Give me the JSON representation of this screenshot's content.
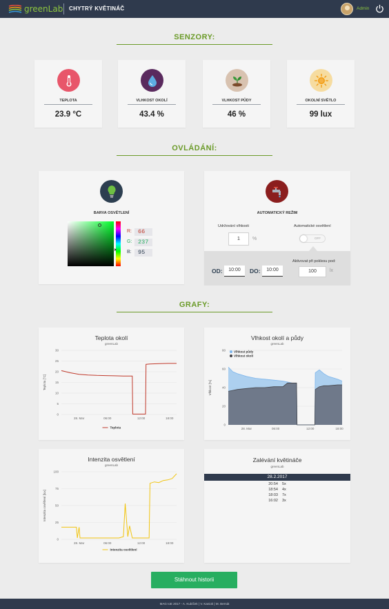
{
  "header": {
    "logo_text": "greenLab",
    "app_title": "CHYTRÝ KVĚTINÁČ",
    "user": "Admin"
  },
  "sections": {
    "sensors": "SENZORY:",
    "control": "OVLÁDÁNÍ:",
    "graphs": "GRAFY:"
  },
  "sensors": [
    {
      "label": "TEPLOTA",
      "value": "23.9 °C",
      "icon": "thermometer-icon",
      "color": "#e8566a"
    },
    {
      "label": "VLHKOST OKOLÍ",
      "value": "43.4 %",
      "icon": "water-drop-icon",
      "color": "#5a2a5e"
    },
    {
      "label": "VLHKOST PŮDY",
      "value": "46 %",
      "icon": "plant-icon",
      "color": "#d8c2b0"
    },
    {
      "label": "OKOLNÍ SVĚTLO",
      "value": "99 lux",
      "icon": "sun-icon",
      "color": "#f6dca0"
    }
  ],
  "lighting": {
    "label": "BARVA OSVĚTLENÍ",
    "r_label": "R:",
    "g_label": "G:",
    "b_label": "B:",
    "r": "66",
    "g": "237",
    "b": "95"
  },
  "auto": {
    "label": "AUTOMATICKÝ REŽIM",
    "humidity_label": "Udržování vlhkosti",
    "humidity_value": "1",
    "humidity_unit": "%",
    "light_label": "Automatické osvětlení",
    "toggle_text": "OFF",
    "od_label": "OD:",
    "od_value": "10:00",
    "do_label": "DO:",
    "do_value": "10:00",
    "threshold_label": "Aktivovat při poklesu pod:",
    "threshold_value": "100",
    "threshold_unit": "lx"
  },
  "charts": {
    "temp": {
      "title": "Teplota okolí",
      "subtitle": "greenLab",
      "ylabel": "Teplota [°C]",
      "legend": "Teplota"
    },
    "humidity": {
      "title": "Vlhkost okolí a půdy",
      "subtitle": "greenLab",
      "ylabel": "Vlhkost [%]",
      "legend_soil": "Vlhkost půdy",
      "legend_air": "Vlhkost okolí"
    },
    "light": {
      "title": "Intenzita osvětlení",
      "subtitle": "greenLab",
      "ylabel": "Intenzita osvětlení [lux]",
      "legend": "Intenzita osvětlení"
    }
  },
  "watering": {
    "title": "Zalévání květináče",
    "subtitle": "greenLab",
    "date": "28.2.2017",
    "rows": [
      {
        "time": "20:54",
        "count": "5x"
      },
      {
        "time": "18:54",
        "count": "4x"
      },
      {
        "time": "18:03",
        "count": "7x"
      },
      {
        "time": "16:02",
        "count": "3x"
      }
    ]
  },
  "download_label": "Stáhnout historii",
  "footer": "MAG IoE 2017 - A. Kubíček | V. Kaniok | M. Bernát",
  "chart_data": [
    {
      "type": "line",
      "title": "Teplota okolí",
      "ylabel": "Teplota [°C]",
      "x_ticks": [
        "28. Mar",
        "06:00",
        "12:00",
        "18:00"
      ],
      "ylim": [
        0,
        30
      ],
      "y_ticks": [
        0,
        5,
        10,
        15,
        20,
        25,
        30
      ],
      "series": [
        {
          "name": "Teplota",
          "color": "#c0392b",
          "x": [
            0,
            1,
            2,
            3,
            4,
            5,
            6,
            7,
            8,
            8.05,
            9.0,
            9.5,
            9.55,
            10,
            11,
            12,
            13
          ],
          "y": [
            20.5,
            19.5,
            18.8,
            18.5,
            18.3,
            18.2,
            18.1,
            18.0,
            18.0,
            0.2,
            0.2,
            0.2,
            23.5,
            23.6,
            23.8,
            23.9,
            23.9
          ]
        }
      ]
    },
    {
      "type": "area",
      "title": "Vlhkost okolí a půdy",
      "ylabel": "Vlhkost [%]",
      "x_ticks": [
        "28. Mar",
        "06:00",
        "12:00",
        "18:00"
      ],
      "ylim": [
        0,
        80
      ],
      "y_ticks": [
        0,
        20,
        40,
        60,
        80
      ],
      "series": [
        {
          "name": "Vlhkost půdy",
          "color": "#7cb5ec",
          "x": [
            0,
            0.5,
            1,
            2,
            3,
            4,
            5,
            6,
            7,
            7.5,
            7.55,
            9.5,
            9.55,
            10,
            10.5,
            11,
            12,
            12.5
          ],
          "y": [
            62,
            57,
            55,
            52,
            50,
            49,
            48,
            47,
            45,
            44,
            0,
            0,
            56,
            59,
            55,
            52,
            49,
            47
          ]
        },
        {
          "name": "Vlhkost okolí",
          "color": "#434348",
          "x": [
            0,
            0.5,
            1,
            2,
            3,
            4,
            5,
            6,
            6.5,
            7,
            7.5,
            7.55,
            9.5,
            9.55,
            10,
            10.5,
            11,
            12,
            12.5
          ],
          "y": [
            36,
            37,
            38,
            39,
            40,
            40,
            41,
            41,
            45,
            45,
            45,
            0,
            0,
            38,
            41,
            42,
            42,
            43,
            43
          ]
        }
      ]
    },
    {
      "type": "line",
      "title": "Intenzita osvětlení",
      "ylabel": "Intenzita osvětlení [lux]",
      "x_ticks": [
        "28. Mar",
        "06:00",
        "12:00",
        "18:00"
      ],
      "ylim": [
        0,
        100
      ],
      "y_ticks": [
        0,
        25,
        50,
        75,
        100
      ],
      "series": [
        {
          "name": "Intenzita osvětlení",
          "color": "#f1c40f",
          "x": [
            0,
            1,
            1.7,
            1.8,
            2.0,
            2.1,
            3,
            5,
            6.5,
            7.0,
            7.2,
            7.5,
            7.7,
            8,
            9,
            9.9,
            10.0,
            10.5,
            11,
            11.5,
            12,
            12.5,
            13
          ],
          "y": [
            18,
            18,
            18,
            2,
            18,
            2,
            2,
            2,
            2,
            4,
            53,
            4,
            20,
            2,
            2,
            2,
            83,
            85,
            84,
            87,
            88,
            90,
            97
          ]
        }
      ]
    }
  ]
}
